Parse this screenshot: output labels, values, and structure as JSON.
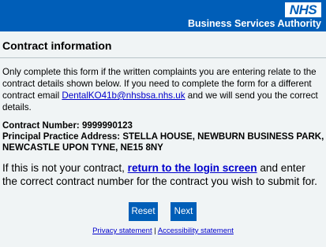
{
  "header": {
    "logo_text": "NHS",
    "org_name": "Business Services Authority",
    "color": "#005eb8"
  },
  "page": {
    "title": "Contract information",
    "intro_before": "Only complete this form if the written complaints you are entering relate to the contract details shown below. If you need to complete the form for a different contract email ",
    "email_link": "DentalKO41b@nhsbsa.nhs.uk",
    "intro_after": " and we will send you the correct details.",
    "contract_number": "Contract Number: 9999990123",
    "practice_address": "Principal Practice Address: STELLA HOUSE, NEWBURN BUSINESS PARK, NEWCASTLE UPON TYNE, NE15 8NY",
    "notice_before": "If this is not your contract, ",
    "login_link": "return to the login screen",
    "notice_after": " and enter the correct contract number for the contract you wish to submit for."
  },
  "buttons": {
    "reset_label": "Reset",
    "next_label": "Next"
  },
  "footer": {
    "privacy_link": "Privacy statement",
    "separator": " | ",
    "accessibility_link": "Accessibility statement"
  }
}
